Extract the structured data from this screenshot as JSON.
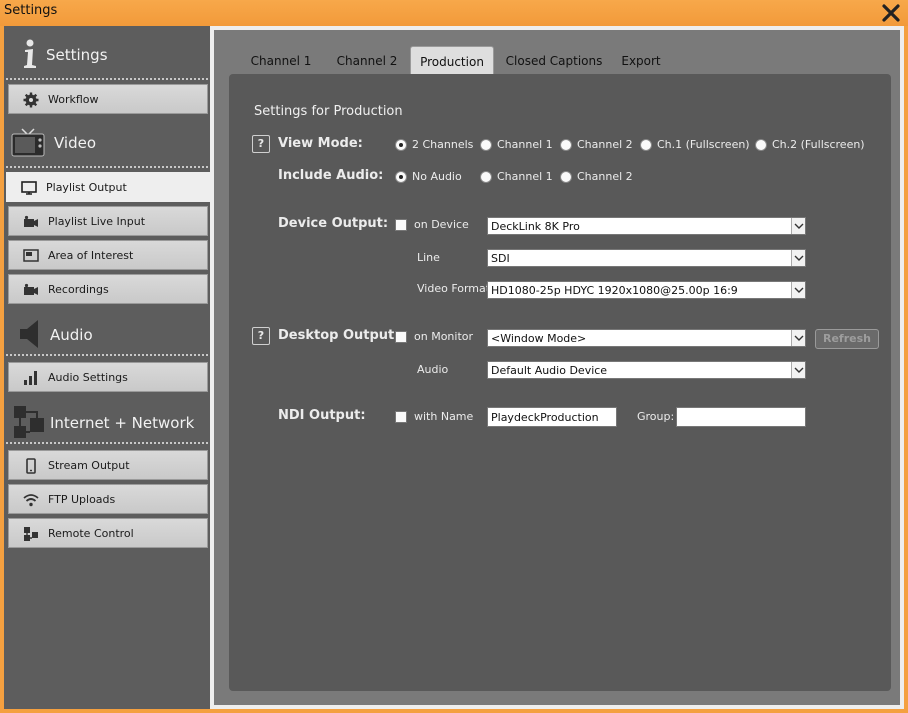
{
  "window": {
    "title": "Settings"
  },
  "sidebar": {
    "sections": [
      {
        "label": "Settings",
        "icon": "info-icon"
      },
      {
        "label": "Video",
        "icon": "tv-icon"
      },
      {
        "label": "Audio",
        "icon": "speaker-icon"
      },
      {
        "label": "Internet + Network",
        "icon": "network-icon"
      }
    ],
    "items": [
      {
        "label": "Workflow",
        "icon": "gear-icon"
      },
      {
        "label": "Playlist Output",
        "icon": "monitor-icon",
        "active": true
      },
      {
        "label": "Playlist Live Input",
        "icon": "camera-icon"
      },
      {
        "label": "Area of Interest",
        "icon": "frame-icon"
      },
      {
        "label": "Recordings",
        "icon": "camera-icon"
      },
      {
        "label": "Audio Settings",
        "icon": "bars-icon"
      },
      {
        "label": "Stream Output",
        "icon": "phone-icon"
      },
      {
        "label": "FTP Uploads",
        "icon": "wifi-icon"
      },
      {
        "label": "Remote Control",
        "icon": "remote-icon"
      }
    ]
  },
  "tabs": [
    {
      "label": "Channel 1"
    },
    {
      "label": "Channel 2"
    },
    {
      "label": "Production",
      "active": true
    },
    {
      "label": "Closed Captions"
    },
    {
      "label": "Export"
    }
  ],
  "content": {
    "heading": "Settings for Production",
    "help_label": "?",
    "view_mode": {
      "label": "View Mode:",
      "options": [
        "2 Channels",
        "Channel 1",
        "Channel 2",
        "Ch.1 (Fullscreen)",
        "Ch.2 (Fullscreen)"
      ],
      "selected": "2 Channels"
    },
    "include_audio": {
      "label": "Include Audio:",
      "options": [
        "No Audio",
        "Channel 1",
        "Channel 2"
      ],
      "selected": "No Audio"
    },
    "device_output": {
      "label": "Device Output:",
      "checkbox_label": "on Device",
      "checked": false,
      "device_value": "DeckLink 8K Pro",
      "line_label": "Line",
      "line_value": "SDI",
      "format_label": "Video Format",
      "format_value": "HD1080-25p HDYC 1920x1080@25.00p 16:9"
    },
    "desktop_output": {
      "label": "Desktop Output:",
      "checkbox_label": "on Monitor",
      "checked": false,
      "monitor_value": "<Window Mode>",
      "refresh_label": "Refresh",
      "audio_label": "Audio",
      "audio_value": "Default Audio Device"
    },
    "ndi_output": {
      "label": "NDI Output:",
      "checkbox_label": "with Name",
      "checked": false,
      "name_value": "PlaydeckProduction",
      "group_label": "Group:",
      "group_value": ""
    }
  }
}
